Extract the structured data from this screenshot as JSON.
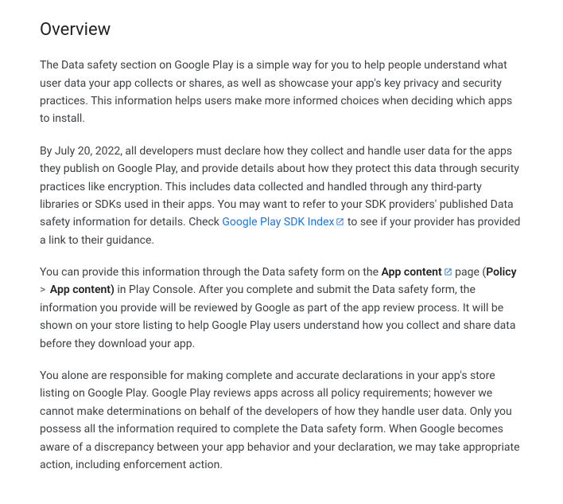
{
  "heading": "Overview",
  "para1": "The Data safety section on Google Play is a simple way for you to help people understand what user data your app collects or shares, as well as showcase your app's key privacy and security practices. This information helps users make more informed choices when deciding which apps to install.",
  "para2_a": "By July 20, 2022, all developers must declare how they collect and handle user data for the apps they publish on Google Play, and provide details about how they protect this data through security practices like encryption. This includes data collected and handled through any third-party libraries or SDKs used in their apps. You may want to refer to your SDK providers' published Data safety information for details. Check ",
  "para2_link": "Google Play SDK Index",
  "para2_b": " to see if your provider has provided a link to their guidance.",
  "para3_a": "You can provide this information through the Data safety form on the ",
  "para3_link": "App content",
  "para3_b": " page (",
  "para3_bold1": "Policy",
  "para3_sep": " > ",
  "para3_bold2": "App content)",
  "para3_c": " in Play Console. After you complete and submit the Data safety form, the information you provide will be reviewed by Google as part of the app review process. It will be shown on your store listing to help Google Play users understand how you collect and share data before they download your app.",
  "para4": "You alone are responsible for making complete and accurate declarations in your app's store listing on Google Play. Google Play reviews apps across all policy requirements; however we cannot make determinations on behalf of the developers of how they handle user data. Only you possess all the information required to complete the Data safety form. When Google becomes aware of a discrepancy between your app behavior and your declaration, we may take appropriate action, including enforcement action."
}
